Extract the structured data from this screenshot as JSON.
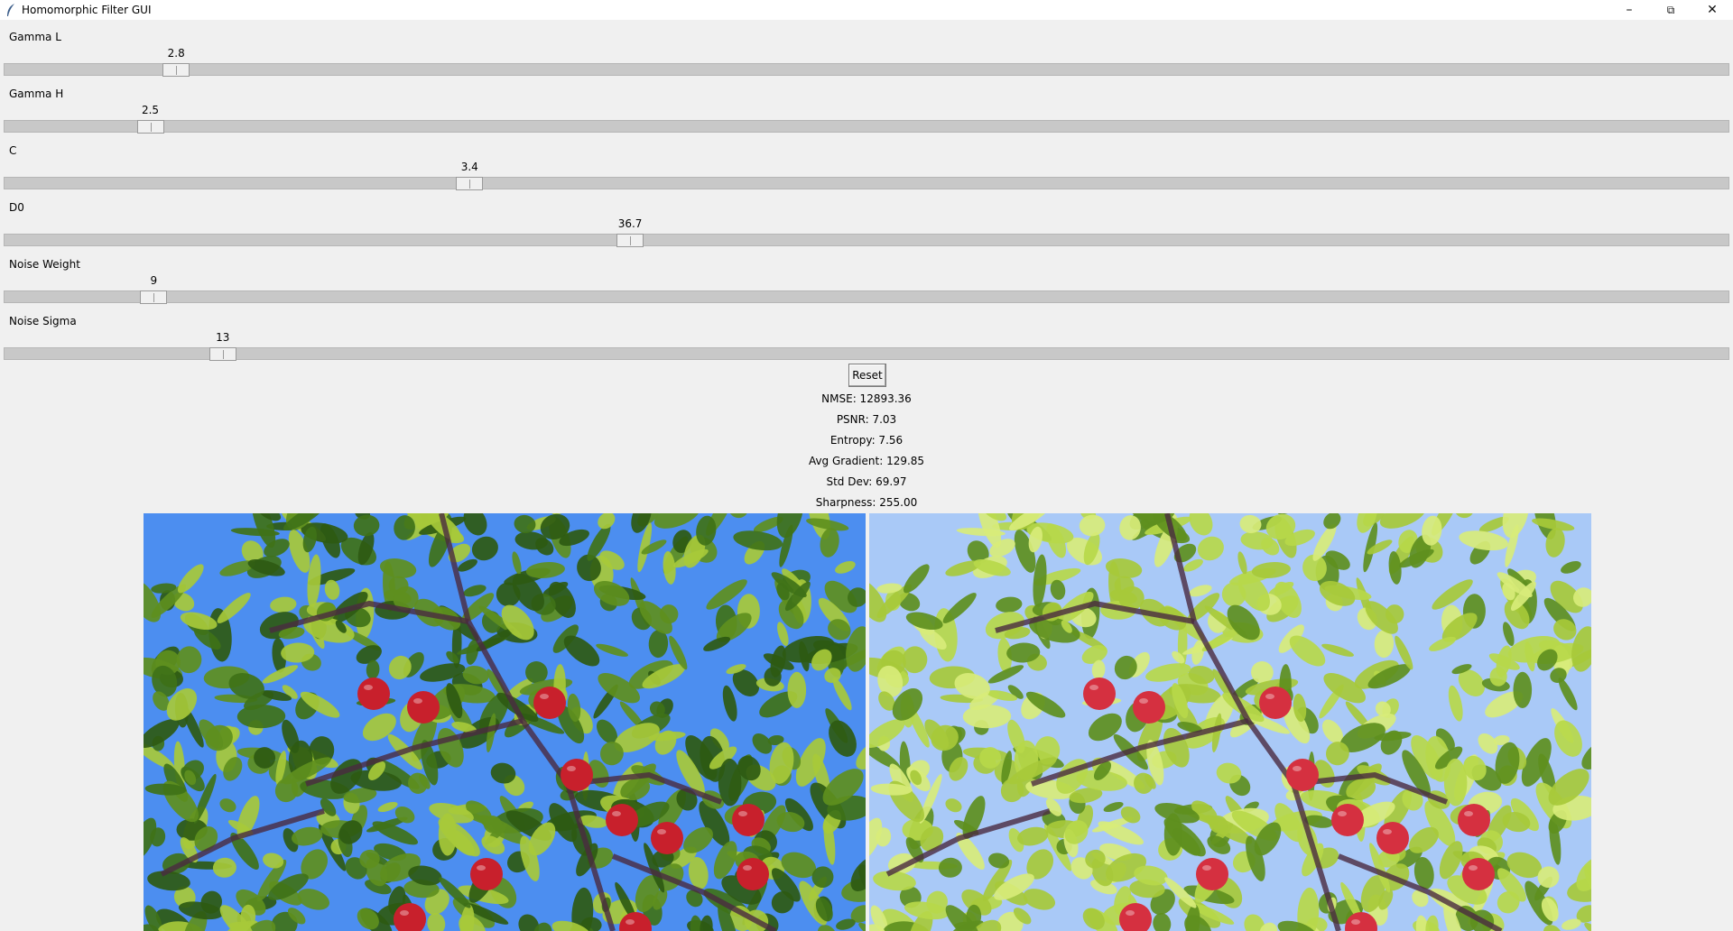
{
  "window": {
    "title": "Homomorphic Filter GUI"
  },
  "sliders": [
    {
      "label": "Gamma L",
      "value": "2.8",
      "level": 0.1
    },
    {
      "label": "Gamma H",
      "value": "2.5",
      "level": 0.085
    },
    {
      "label": "C",
      "value": "3.4",
      "level": 0.27
    },
    {
      "label": "D0",
      "value": "36.7",
      "level": 0.363
    },
    {
      "label": "Noise Weight",
      "value": "9",
      "level": 0.087
    },
    {
      "label": "Noise Sigma",
      "value": "13",
      "level": 0.127
    }
  ],
  "reset_label": "Reset",
  "metrics": [
    "NMSE: 12893.36",
    "PSNR: 7.03",
    "Entropy: 7.56",
    "Avg Gradient: 129.85",
    "Std Dev: 69.97",
    "Sharpness: 255.00"
  ],
  "colors": {
    "sky_original": "#4c8ef0",
    "sky_filtered": "#a9c9f7",
    "leaf_dark": "#2e5a12",
    "leaf_mid": "#5e8f1e",
    "leaf_light": "#a7c93a",
    "leaf_filtered": "#b7d84a",
    "apple": "#c8202c",
    "branch": "#4a2a40"
  },
  "images": {
    "original": "apple-tree-photo-original",
    "filtered": "apple-tree-photo-filtered"
  }
}
